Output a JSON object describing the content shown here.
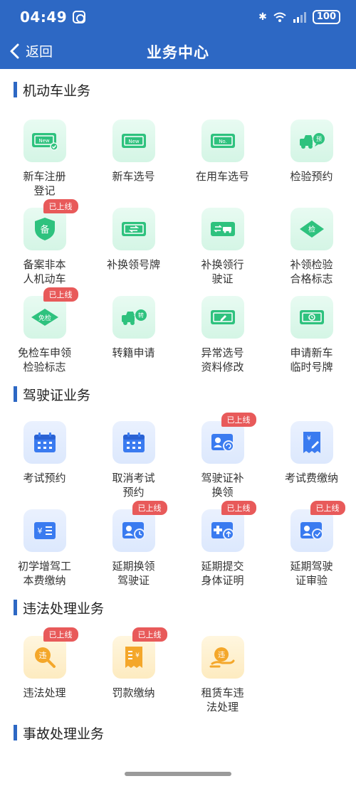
{
  "status": {
    "time": "04:49",
    "battery": "100"
  },
  "nav": {
    "back": "返回",
    "title": "业务中心"
  },
  "sections": [
    {
      "title": "机动车业务"
    },
    {
      "title": "驾驶证业务"
    },
    {
      "title": "违法处理业务"
    },
    {
      "title": "事故处理业务"
    }
  ],
  "badge": "已上线",
  "vehicle": [
    {
      "label1": "新车注册",
      "label2": "登记",
      "icon": "new-plate-check-icon",
      "text": "New"
    },
    {
      "label1": "新车选号",
      "label2": "",
      "icon": "new-plate-icon",
      "text": "New"
    },
    {
      "label1": "在用车选号",
      "label2": "",
      "icon": "plate-number-icon",
      "text": "No."
    },
    {
      "label1": "检验预约",
      "label2": "",
      "icon": "truck-appointment-icon",
      "text": "预"
    },
    {
      "label1": "备案非本",
      "label2": "人机动车",
      "icon": "shield-filing-icon",
      "text": "备"
    },
    {
      "label1": "补换领号牌",
      "label2": "",
      "icon": "plate-exchange-icon",
      "text": ""
    },
    {
      "label1": "补换领行",
      "label2": "驶证",
      "icon": "license-exchange-icon",
      "text": ""
    },
    {
      "label1": "补领检验",
      "label2": "合格标志",
      "icon": "inspection-mark-icon",
      "text": "检"
    },
    {
      "label1": "免检车申领",
      "label2": "检验标志",
      "icon": "exempt-mark-icon",
      "text": "免检"
    },
    {
      "label1": "转籍申请",
      "label2": "",
      "icon": "transfer-truck-icon",
      "text": "转"
    },
    {
      "label1": "异常选号",
      "label2": "资料修改",
      "icon": "edit-plate-icon",
      "text": ""
    },
    {
      "label1": "申请新车",
      "label2": "临时号牌",
      "icon": "temp-plate-icon",
      "text": ""
    }
  ],
  "license": [
    {
      "label1": "考试预约",
      "label2": "",
      "icon": "calendar-icon"
    },
    {
      "label1": "取消考试",
      "label2": "预约",
      "icon": "calendar-cancel-icon"
    },
    {
      "label1": "驾驶证补",
      "label2": "换领",
      "icon": "license-renew-icon"
    },
    {
      "label1": "考试费缴纳",
      "label2": "",
      "icon": "receipt-pay-icon"
    },
    {
      "label1": "初学增驾工",
      "label2": "本费缴纳",
      "icon": "fee-list-icon"
    },
    {
      "label1": "延期换领",
      "label2": "驾驶证",
      "icon": "license-clock-icon"
    },
    {
      "label1": "延期提交",
      "label2": "身体证明",
      "icon": "health-upload-icon"
    },
    {
      "label1": "延期驾驶",
      "label2": "证审验",
      "icon": "license-verify-icon"
    }
  ],
  "violation": [
    {
      "label1": "违法处理",
      "label2": "",
      "icon": "violation-search-icon",
      "text": "违"
    },
    {
      "label1": "罚款缴纳",
      "label2": "",
      "icon": "fine-receipt-icon",
      "text": ""
    },
    {
      "label1": "租赁车违",
      "label2": "法处理",
      "icon": "rental-violation-icon",
      "text": "违"
    }
  ]
}
